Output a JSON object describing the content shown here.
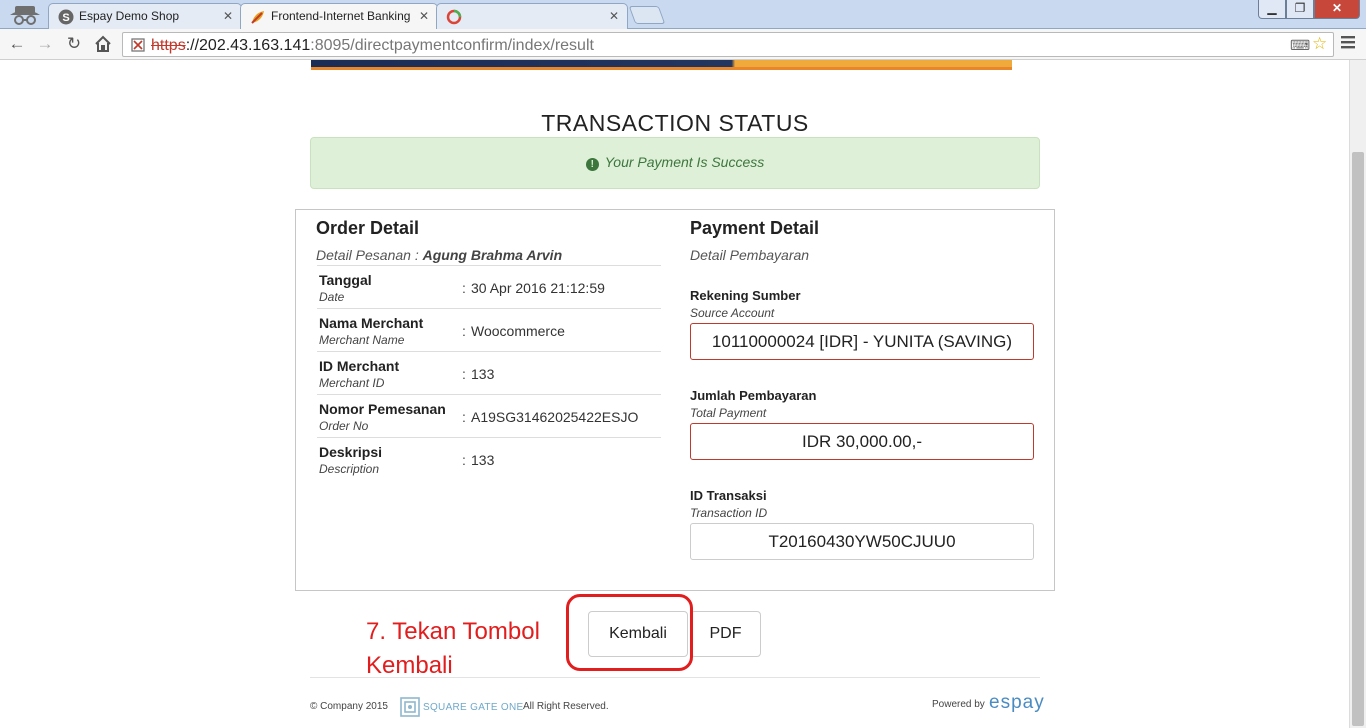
{
  "browser": {
    "tabs": [
      {
        "label": "Espay Demo Shop",
        "favicon": "espay-s-icon",
        "active": false
      },
      {
        "label": "Frontend-Internet Banking",
        "favicon": "bank-leaf-icon",
        "active": true
      },
      {
        "label": "",
        "favicon": "chrome-loading-icon",
        "active": false
      }
    ],
    "url_scheme": "https",
    "url_host": "://202.43.163.141",
    "url_rest": ":8095/directpaymentconfirm/index/result"
  },
  "page": {
    "title": "TRANSACTION STATUS",
    "alert": "Your Payment Is Success",
    "order_detail": {
      "title": "Order Detail",
      "subtitle_label": "Detail Pesanan : ",
      "customer": "Agung Brahma Arvin",
      "rows": [
        {
          "label": "Tanggal",
          "sub": "Date",
          "value": "30 Apr 2016 21:12:59"
        },
        {
          "label": "Nama Merchant",
          "sub": "Merchant Name",
          "value": "Woocommerce"
        },
        {
          "label": "ID Merchant",
          "sub": "Merchant ID",
          "value": "133"
        },
        {
          "label": "Nomor Pemesanan",
          "sub": "Order No",
          "value": "A19SG31462025422ESJO"
        },
        {
          "label": "Deskripsi",
          "sub": "Description",
          "value": "133"
        }
      ]
    },
    "payment_detail": {
      "title": "Payment Detail",
      "subtitle": "Detail Pembayaran",
      "source_label": "Rekening Sumber",
      "source_sub": "Source Account",
      "source_value": "10110000024 [IDR] - YUNITA (SAVING)",
      "amount_label": "Jumlah Pembayaran",
      "amount_sub": "Total Payment",
      "amount_value": "IDR 30,000.00,-",
      "txn_label": "ID Transaksi",
      "txn_sub": "Transaction ID",
      "txn_value": "T20160430YW50CJUU0"
    },
    "buttons": {
      "back": "Kembali",
      "pdf": "PDF"
    },
    "annotation": "7. Tekan Tombol Kembali",
    "footer": {
      "copyright": "© Company 2015",
      "logo_text": "SQUARE GATE ONE",
      "rights": "All Right Reserved.",
      "powered": "Powered by",
      "brand": "espay"
    }
  },
  "colors": {
    "alert_bg": "#dff0d8",
    "alert_text": "#3c763d",
    "annotation_red": "#e11d1d",
    "field_border_red": "#c0392b",
    "espay_blue": "#4a8bc2"
  }
}
